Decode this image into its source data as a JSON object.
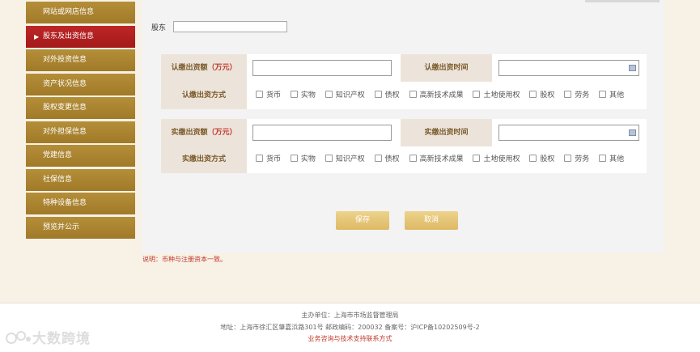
{
  "sidebar": {
    "items": [
      {
        "label": "网站或网店信息"
      },
      {
        "label": "股东及出资信息"
      },
      {
        "label": "对外投资信息"
      },
      {
        "label": "资产状况信息"
      },
      {
        "label": "股权变更信息"
      },
      {
        "label": "对外担保信息"
      },
      {
        "label": "党建信息"
      },
      {
        "label": "社保信息"
      },
      {
        "label": "特种设备信息"
      },
      {
        "label": "预览并公示"
      }
    ]
  },
  "form": {
    "shareholder_label": "股东",
    "subscribed": {
      "amount_label": "认缴出资额",
      "amount_unit": "（万元）",
      "time_label": "认缴出资时间",
      "method_label": "认缴出资方式"
    },
    "paid": {
      "amount_label": "实缴出资额",
      "amount_unit": "（万元）",
      "time_label": "实缴出资时间",
      "method_label": "实缴出资方式"
    },
    "methods": [
      "货币",
      "实物",
      "知识产权",
      "债权",
      "高新技术成果",
      "土地使用权",
      "股权",
      "劳务",
      "其他"
    ]
  },
  "buttons": {
    "save": "保存",
    "cancel": "取消"
  },
  "note": "说明：币种与注册资本一致。",
  "footer": {
    "line1": "主办单位：上海市市场监督管理局",
    "line2": "地址：上海市徐汇区肇嘉浜路301号 邮政编码：200032 备案号：沪ICP备10202509号-2",
    "line3": "业务咨询与技术支持联系方式"
  },
  "watermark": "大数跨境"
}
